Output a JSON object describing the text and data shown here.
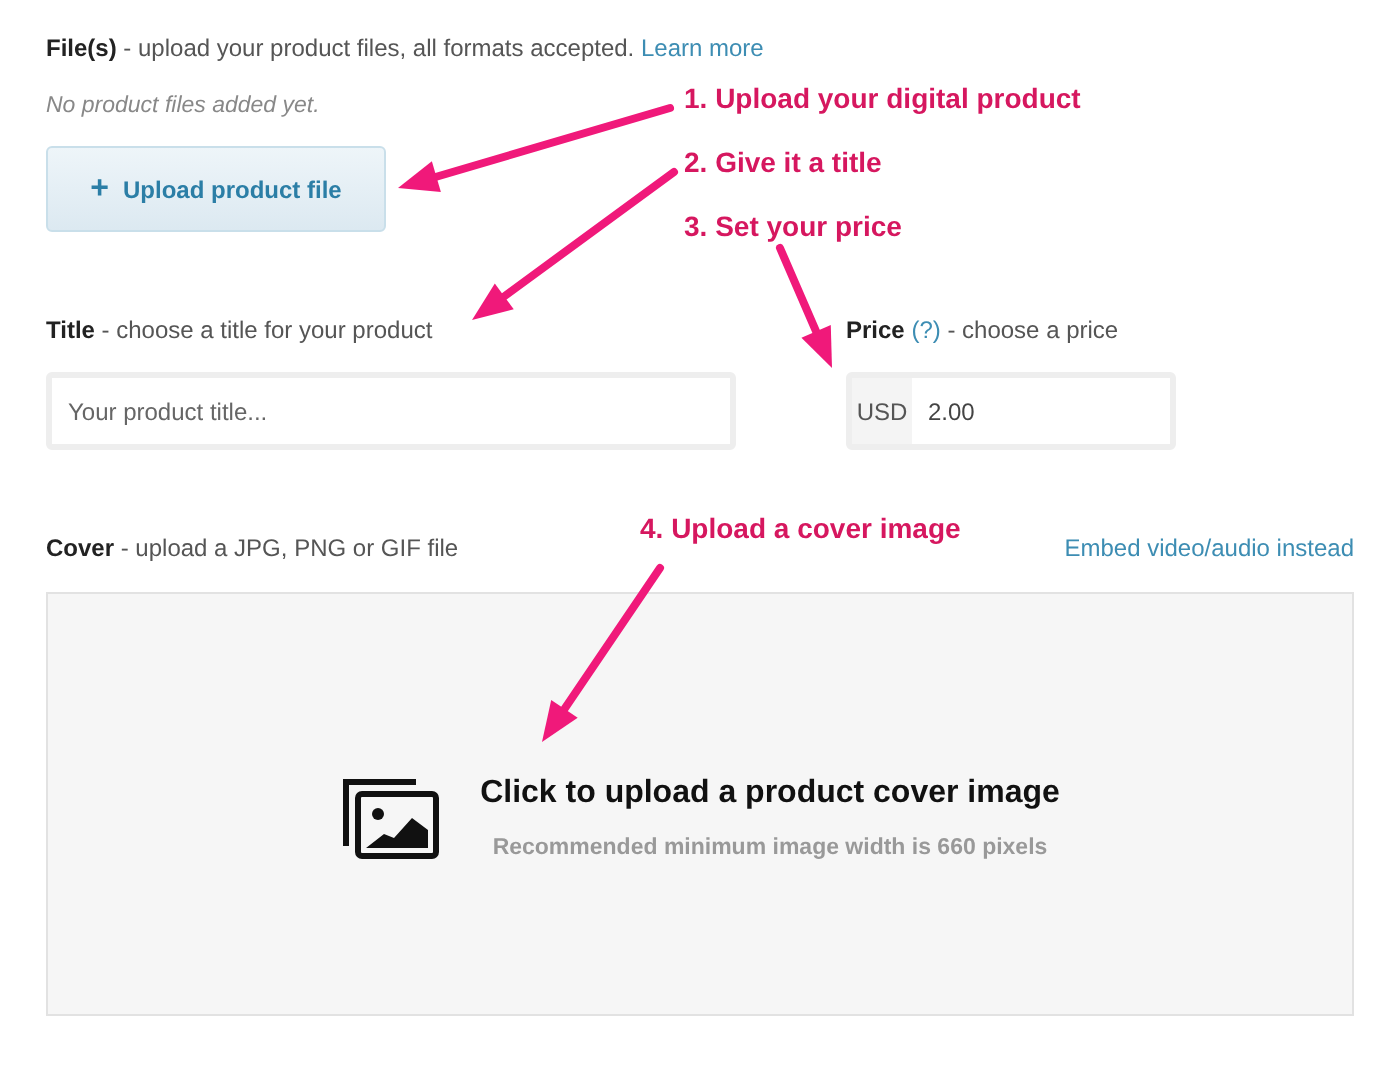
{
  "files": {
    "label": "File(s)",
    "hint": " - upload your product files, all formats accepted. ",
    "link": "Learn more",
    "empty": "No product files added yet.",
    "button": "Upload product file",
    "button_icon": "+"
  },
  "title": {
    "label": "Title",
    "hint": " - choose a title for your product",
    "placeholder": "Your product title..."
  },
  "price": {
    "label": "Price",
    "help": "(?)",
    "hint": " - choose a price",
    "currency": "USD",
    "value": "2.00"
  },
  "cover": {
    "label": "Cover",
    "hint": " - upload a JPG, PNG or GIF file",
    "link": "Embed video/audio instead",
    "prompt": "Click to upload a product cover image",
    "note": "Recommended minimum image width is 660 pixels"
  },
  "annotations": [
    {
      "text": "1. Upload your digital product"
    },
    {
      "text": "2. Give it a title"
    },
    {
      "text": "3. Set your price"
    },
    {
      "text": "4. Upload a cover image"
    }
  ]
}
